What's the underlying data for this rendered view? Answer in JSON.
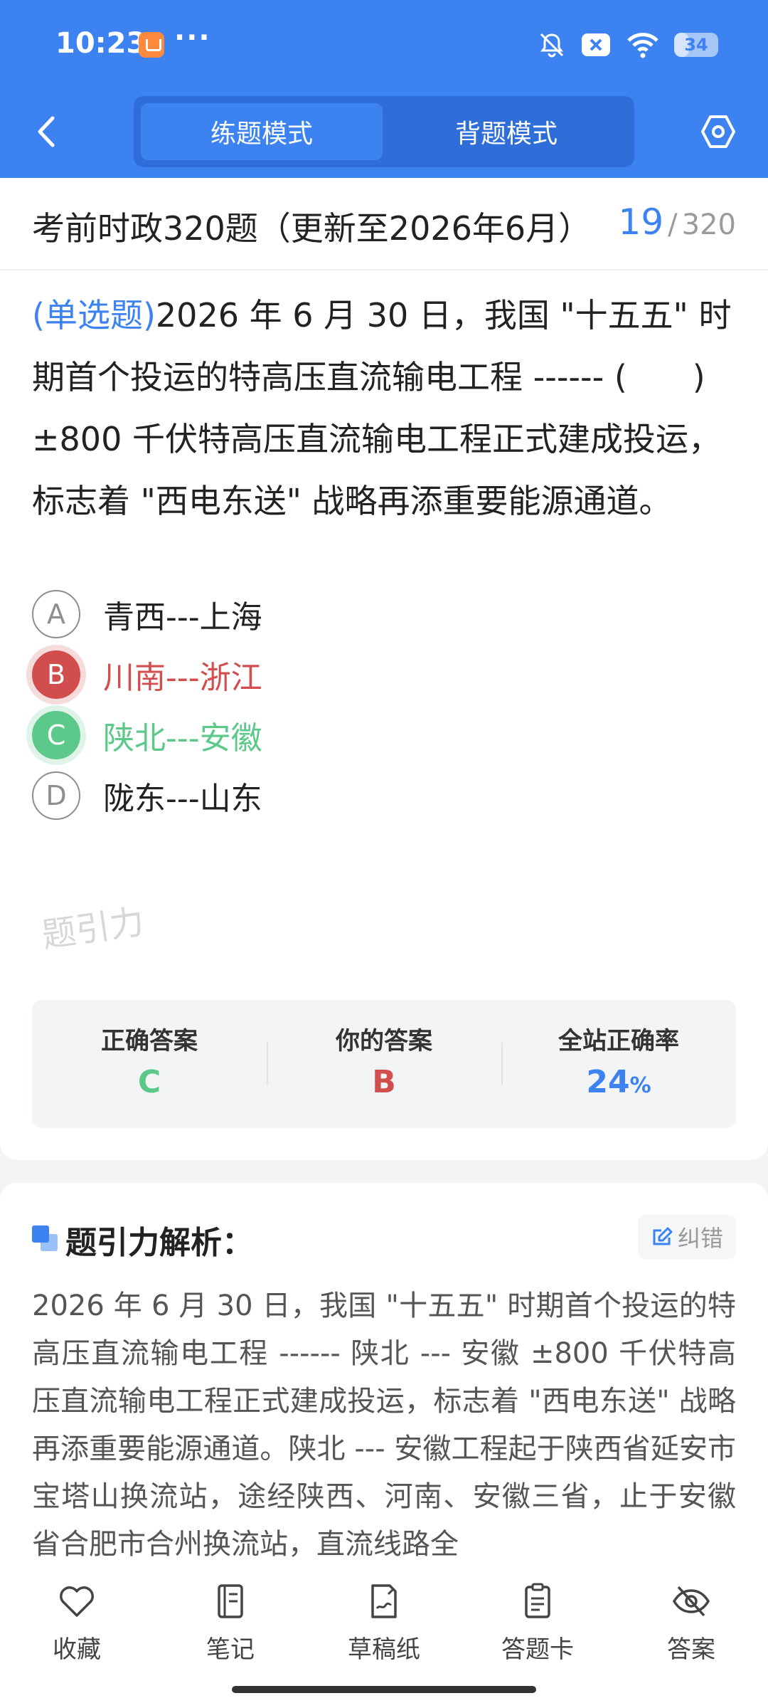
{
  "status": {
    "time": "10:23",
    "dots": "···",
    "battery": "34",
    "battery_level": 0.34
  },
  "nav": {
    "tab_practice": "练题模式",
    "tab_memorize": "背题模式",
    "active_tab": "practice"
  },
  "exam": {
    "title": "考前时政320题（更新至2026年6月）",
    "current": "19",
    "separator": "/",
    "total": "320"
  },
  "question": {
    "type": "(单选题)",
    "text": "2026 年 6 月 30 日，我国 \"十五五\" 时期首个投运的特高压直流输电工程 ------ (　　) ±800 千伏特高压直流输电工程正式建成投运，标志着 \"西电东送\" 战略再添重要能源通道。"
  },
  "options": [
    {
      "letter": "A",
      "text": "青西---上海",
      "state": "normal"
    },
    {
      "letter": "B",
      "text": "川南---浙江",
      "state": "wrong"
    },
    {
      "letter": "C",
      "text": "陕北---安徽",
      "state": "correct"
    },
    {
      "letter": "D",
      "text": "陇东---山东",
      "state": "normal"
    }
  ],
  "watermark": "题引力",
  "summary": {
    "correct_label": "正确答案",
    "correct_value": "C",
    "yours_label": "你的答案",
    "yours_value": "B",
    "rate_label": "全站正确率",
    "rate_value": "24",
    "rate_unit": "%",
    "colors": {
      "correct": "#5cc98a",
      "wrong": "#d24d4d",
      "accent": "#3c82f0"
    }
  },
  "analysis": {
    "title": "题引力解析：",
    "correct_button": "纠错",
    "text": "2026 年 6 月 30 日，我国 \"十五五\" 时期首个投运的特高压直流输电工程 ------ 陕北 --- 安徽 ±800 千伏特高压直流输电工程正式建成投运，标志着 \"西电东送\" 战略再添重要能源通道。陕北 --- 安徽工程起于陕西省延安市宝塔山换流站，途经陕西、河南、安徽三省，止于安徽省合肥市合州换流站，直流线路全"
  },
  "bottom_bar": [
    {
      "label": "收藏",
      "icon": "heart-icon"
    },
    {
      "label": "笔记",
      "icon": "notebook-icon"
    },
    {
      "label": "草稿纸",
      "icon": "draft-icon"
    },
    {
      "label": "答题卡",
      "icon": "answer-card-icon"
    },
    {
      "label": "答案",
      "icon": "eye-off-icon"
    }
  ]
}
